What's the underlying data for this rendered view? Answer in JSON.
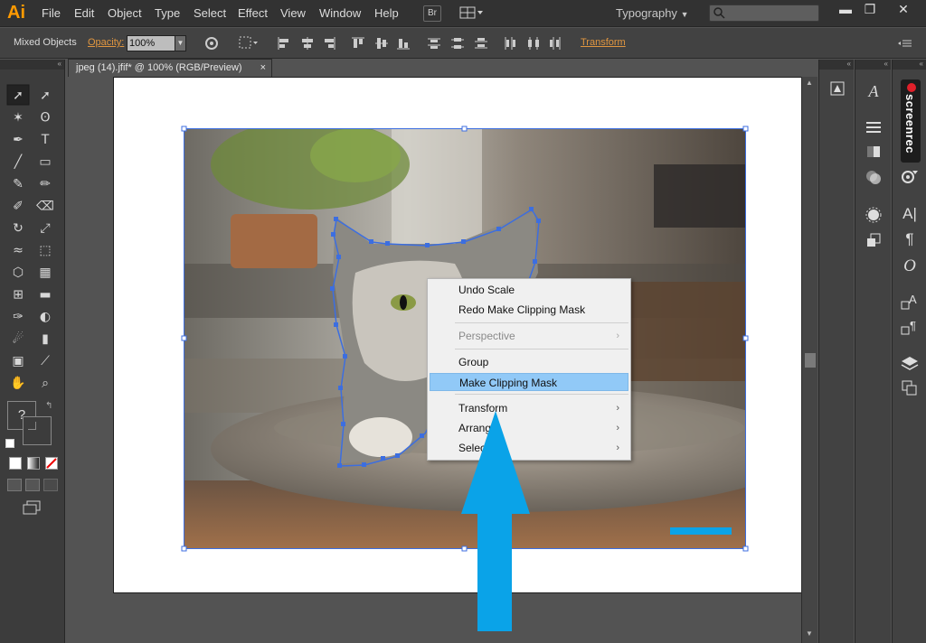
{
  "app": {
    "logo": "Ai",
    "menus": [
      "File",
      "Edit",
      "Object",
      "Type",
      "Select",
      "Effect",
      "View",
      "Window",
      "Help"
    ],
    "bridge_button": "Br",
    "workspace": "Typography",
    "window_controls": [
      "minimize",
      "restore",
      "close"
    ]
  },
  "control_bar": {
    "object_type": "Mixed Objects",
    "opacity_label": "Opacity:",
    "opacity_value": "100%",
    "transform_label": "Transform"
  },
  "document": {
    "tab_title": "jpeg (14).jfif* @ 100% (RGB/Preview)",
    "tab_close": "×"
  },
  "context_menu": {
    "items": [
      {
        "label": "Undo Scale",
        "enabled": true,
        "submenu": false
      },
      {
        "label": "Redo Make Clipping Mask",
        "enabled": true,
        "submenu": false
      },
      {
        "label": "Perspective",
        "enabled": false,
        "submenu": true
      },
      {
        "label": "Group",
        "enabled": true,
        "submenu": false
      },
      {
        "label": "Make Clipping Mask",
        "enabled": true,
        "submenu": false,
        "highlighted": true
      },
      {
        "label": "Transform",
        "enabled": true,
        "submenu": true
      },
      {
        "label": "Arrange",
        "enabled": true,
        "submenu": true
      },
      {
        "label": "Select",
        "enabled": true,
        "submenu": true
      }
    ]
  },
  "toolbar": {
    "fill_stroke_help": "?",
    "tool_icons": [
      "selection-tool",
      "direct-selection-tool",
      "magic-wand-tool",
      "lasso-tool",
      "pen-tool",
      "type-tool",
      "line-tool",
      "rectangle-tool",
      "paintbrush-tool",
      "pencil-tool",
      "blob-brush-tool",
      "eraser-tool",
      "rotate-tool",
      "scale-tool",
      "width-tool",
      "free-transform-tool",
      "shape-builder-tool",
      "perspective-grid-tool",
      "mesh-tool",
      "gradient-tool",
      "eyedropper-tool",
      "blend-tool",
      "symbol-sprayer-tool",
      "column-graph-tool",
      "artboard-tool",
      "slice-tool",
      "hand-tool",
      "zoom-tool"
    ]
  },
  "panels": {
    "screenrec_label": "screenrec"
  },
  "colors": {
    "menubar": "#323232",
    "accent_orange": "#e09640",
    "highlight": "#91c9f7",
    "annotation_arrow": "#0aa3e8",
    "selection": "#3c6ee0"
  }
}
